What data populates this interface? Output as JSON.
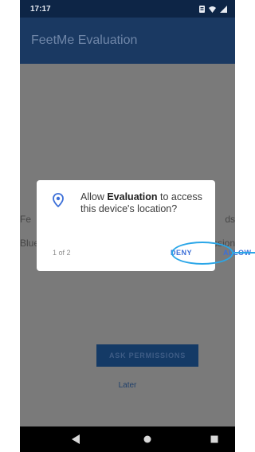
{
  "status_bar": {
    "time": "17:17"
  },
  "app_bar": {
    "title": "FeetMe Evaluation"
  },
  "background": {
    "left_line_1": "Fe",
    "right_line_1": "ds",
    "left_line_2": "Blue",
    "right_line_2": "ssion",
    "ask_permissions_label": "ASK PERMISSIONS",
    "later_label": "Later"
  },
  "dialog": {
    "message_prefix": "Allow ",
    "message_app": "Evaluation",
    "message_suffix": " to access this device's location?",
    "counter": "1 of 2",
    "deny_label": "DENY",
    "allow_label": "ALLOW"
  },
  "colors": {
    "status_bar": "#0d2546",
    "app_bar": "#1a3962",
    "scrim": "#7a7a7a",
    "dialog_accent": "#3c6fd8",
    "highlight": "#2aa6e8"
  },
  "icons": {
    "dialog": "location-pin-icon",
    "nav_back": "back-triangle-icon",
    "nav_home": "home-circle-icon",
    "nav_recent": "recent-square-icon"
  }
}
